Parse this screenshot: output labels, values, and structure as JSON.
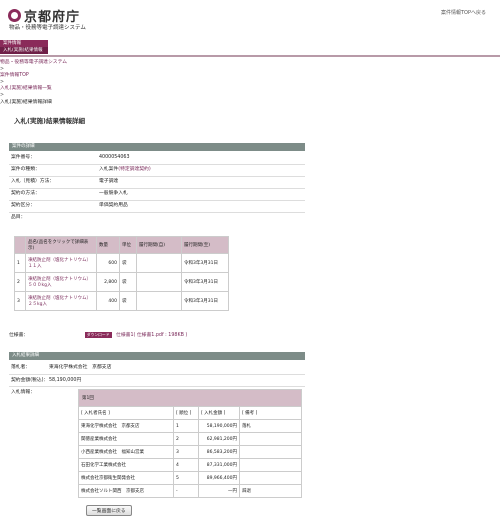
{
  "header": {
    "logo_text": "京都府庁",
    "system_name": "物品・役務等電子調達システム",
    "top_link": "案件情報TOPへ戻る"
  },
  "nav": {
    "tab1": "案件情報",
    "tab2": "入札(実施)結果情報"
  },
  "breadcrumbs": {
    "c1": "物品・役務等電子調達システム",
    "c2": "案件情報TOP",
    "c3": "入札(実施)結果情報一覧",
    "c4": "入札(実施)結果情報詳細",
    "sep": ">"
  },
  "page_title": "入札(実施)結果情報詳細",
  "case_section": {
    "title": "案件の詳細",
    "fields": [
      {
        "label": "案件番号：",
        "value": "4000054063"
      },
      {
        "label": "案件の種類：",
        "value": "入札案件",
        "link": "(特定調達契約)"
      },
      {
        "label": "入札（見積）方法：",
        "value": "電子調達"
      },
      {
        "label": "契約の方法：",
        "value": "一般競争入札"
      },
      {
        "label": "契約区分：",
        "value": "単価契約用品"
      },
      {
        "label": "品目：",
        "value": ""
      }
    ]
  },
  "items_table": {
    "headers": [
      "",
      "品名(品名をクリックで詳細表示)",
      "数量",
      "単位",
      "履行期間(自)",
      "履行期間(至)"
    ],
    "rows": [
      {
        "no": "1",
        "name": "凍結防止剤（塩化ナトリウム）１１入",
        "qty": "600",
        "unit": "袋",
        "from": "",
        "to": "令和3年3月31日"
      },
      {
        "no": "2",
        "name": "凍結防止剤（塩化ナトリウム）５００kg入",
        "qty": "2,800",
        "unit": "袋",
        "from": "",
        "to": "令和3年3月31日"
      },
      {
        "no": "3",
        "name": "凍結防止剤（塩化ナトリウム）２５kg入",
        "qty": "400",
        "unit": "袋",
        "from": "",
        "to": "令和3年3月31日"
      }
    ]
  },
  "spec": {
    "label": "仕様書：",
    "download_label": "ダウンロード",
    "link": "仕様書1( 仕様書1.pdf : 198KB )"
  },
  "result_section": {
    "title": "入札結果詳細",
    "winner_label": "落札者：",
    "winner_value": "東海化学株式会社　京都支店",
    "amount_label": "契約金額(税込)：",
    "amount_value": "58,190,000円",
    "bid_info_label": "入札情報："
  },
  "bids_table": {
    "round": "第1回",
    "headers": [
      "[ 入札者氏名 ]",
      "[ 順位 ]",
      "[ 入札金額 ]",
      "[ 備考 ]"
    ],
    "rows": [
      {
        "name": "東海化学株式会社　京都支店",
        "rank": "1",
        "amount": "58,190,000円",
        "note": "落札"
      },
      {
        "name": "関徳産業株式会社",
        "rank": "2",
        "amount": "62,981,200円",
        "note": ""
      },
      {
        "name": "小西産業株式会社　福知山営業",
        "rank": "3",
        "amount": "86,583,200円",
        "note": ""
      },
      {
        "name": "石田化学工業株式会社",
        "rank": "4",
        "amount": "87,331,000円",
        "note": ""
      },
      {
        "name": "株式会社京都衛生関発会社",
        "rank": "5",
        "amount": "89,966,400円",
        "note": ""
      },
      {
        "name": "株式会社ソルト関西　京都支店",
        "rank": "-",
        "amount": "一円",
        "note": "辞退"
      }
    ]
  },
  "back_button": "一覧画面に戻る",
  "colors": {
    "brand": "#8a2b5a",
    "section": "#7d8c88",
    "table_header": "#d4bcc7"
  }
}
